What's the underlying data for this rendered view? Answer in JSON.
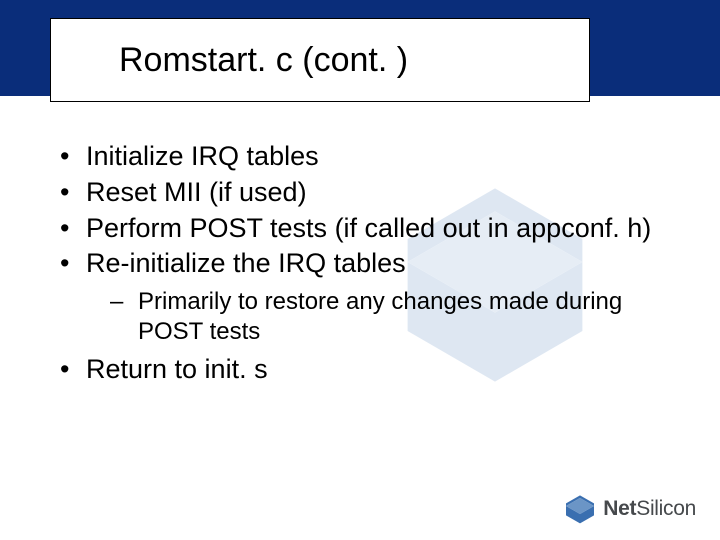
{
  "title": "Romstart. c (cont. )",
  "bullets": [
    "Initialize IRQ tables",
    "Reset MII (if used)",
    "Perform POST tests (if called out in appconf. h)",
    "Re-initialize the IRQ tables"
  ],
  "sub_bullet": "Primarily to restore any changes made during POST tests",
  "last_bullet": "Return to init. s",
  "logo": {
    "net": "Net",
    "silicon": "Silicon"
  },
  "colors": {
    "header": "#0a2d7a",
    "logo_blue": "#3a6fb0"
  }
}
